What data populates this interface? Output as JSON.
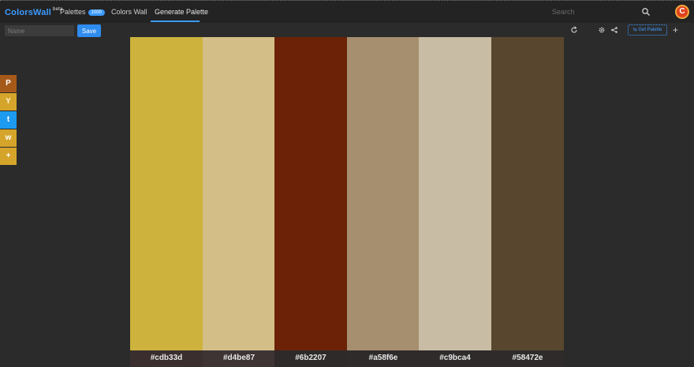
{
  "header": {
    "brand": "ColorsWall",
    "brand_badge": "beta",
    "nav_palettes": "Palettes",
    "palettes_count": "1000",
    "nav_colors_wall": "Colors Wall",
    "nav_generate": "Generate Palette",
    "search_placeholder": "Search",
    "avatar_letter": "C"
  },
  "toolbar": {
    "name_placeholder": "Name",
    "save_label": "Save",
    "export_label": "Get Palette",
    "add_label": "+"
  },
  "share": {
    "pinterest": "P",
    "hackernews": "Y",
    "twitter": "t",
    "weibo": "w",
    "more": "+"
  },
  "palette": {
    "colors": [
      {
        "hex": "#cdb33d",
        "label": "#cdb33d",
        "label_bg": "#3a2e2e"
      },
      {
        "hex": "#d4be87",
        "label": "#d4be87",
        "label_bg": "#3e3434"
      },
      {
        "hex": "#6b2207",
        "label": "#6b2207",
        "label_bg": "#2f2a2a"
      },
      {
        "hex": "#a58f6e",
        "label": "#a58f6e",
        "label_bg": "#2f2b2b"
      },
      {
        "hex": "#c9bca4",
        "label": "#c9bca4",
        "label_bg": "#2f2b2b"
      },
      {
        "hex": "#58472e",
        "label": "#58472e",
        "label_bg": "#2f2b2b"
      }
    ]
  },
  "icons": {
    "search": "search-icon",
    "refresh": "refresh-icon",
    "settings": "gear-icon",
    "share": "share-icon",
    "export": "export-icon"
  },
  "colors": {
    "accent": "#3b9bff",
    "save_button": "#2f8cf0",
    "background": "#2b2b2b"
  }
}
